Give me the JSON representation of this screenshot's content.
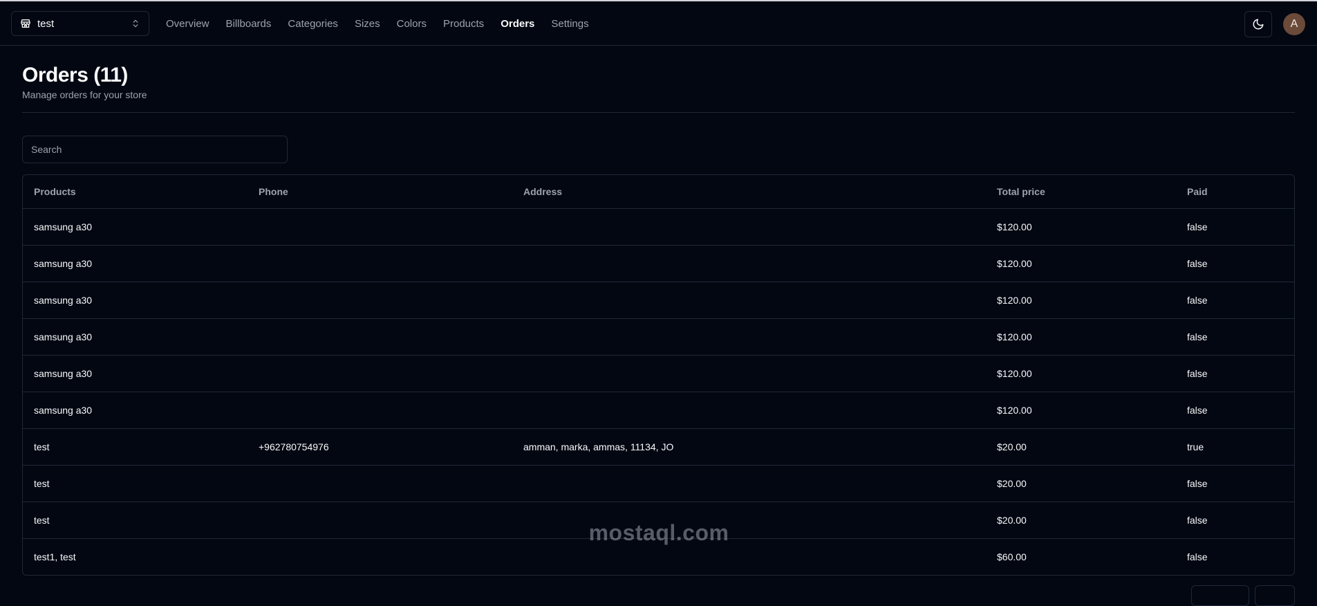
{
  "store": {
    "name": "test",
    "icon": "store-icon"
  },
  "nav": {
    "links": [
      {
        "label": "Overview",
        "active": false
      },
      {
        "label": "Billboards",
        "active": false
      },
      {
        "label": "Categories",
        "active": false
      },
      {
        "label": "Sizes",
        "active": false
      },
      {
        "label": "Colors",
        "active": false
      },
      {
        "label": "Products",
        "active": false
      },
      {
        "label": "Orders",
        "active": true
      },
      {
        "label": "Settings",
        "active": false
      }
    ]
  },
  "user": {
    "avatar_initial": "A"
  },
  "page": {
    "title": "Orders (11)",
    "subtitle": "Manage orders for your store"
  },
  "search": {
    "placeholder": "Search"
  },
  "table": {
    "columns": [
      "Products",
      "Phone",
      "Address",
      "Total price",
      "Paid"
    ],
    "rows": [
      [
        "samsung a30",
        "",
        "",
        "$120.00",
        "false"
      ],
      [
        "samsung a30",
        "",
        "",
        "$120.00",
        "false"
      ],
      [
        "samsung a30",
        "",
        "",
        "$120.00",
        "false"
      ],
      [
        "samsung a30",
        "",
        "",
        "$120.00",
        "false"
      ],
      [
        "samsung a30",
        "",
        "",
        "$120.00",
        "false"
      ],
      [
        "samsung a30",
        "",
        "",
        "$120.00",
        "false"
      ],
      [
        "test",
        "+962780754976",
        "amman, marka, ammas, 11134, JO",
        "$20.00",
        "true"
      ],
      [
        "test",
        "",
        "",
        "$20.00",
        "false"
      ],
      [
        "test",
        "",
        "",
        "$20.00",
        "false"
      ],
      [
        "test1, test",
        "",
        "",
        "$60.00",
        "false"
      ]
    ]
  },
  "watermark": {
    "text": "mostaql.com"
  },
  "colors": {
    "background": "#030712",
    "border": "#1f2937",
    "muted": "#9ca3af",
    "text": "#f9fafb",
    "avatar": "#6b4a3a"
  }
}
